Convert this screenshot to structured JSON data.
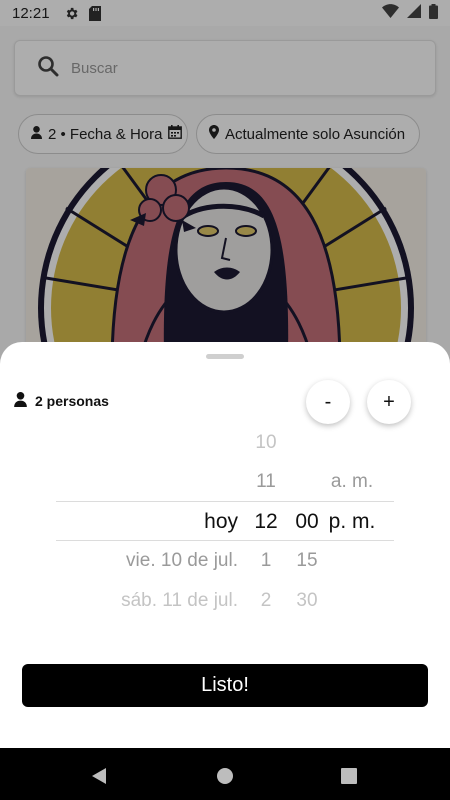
{
  "status_bar": {
    "time": "12:21",
    "icons": [
      "settings-icon",
      "sd-card-icon",
      "wifi-icon",
      "signal-icon",
      "battery-icon"
    ]
  },
  "search": {
    "placeholder": "Buscar",
    "icon": "search-icon"
  },
  "filters": {
    "people_date_chip": "2 • Fecha & Hora",
    "location_chip": "Actualmente solo Asunción"
  },
  "sheet": {
    "people_label": "2 personas",
    "minus_label": "-",
    "plus_label": "+",
    "picker": {
      "date": [
        {
          "label": "",
          "state": "n2"
        },
        {
          "label": "",
          "state": "n1"
        },
        {
          "label": "hoy",
          "state": "sel"
        },
        {
          "label": "vie. 10 de jul.",
          "state": "n1"
        },
        {
          "label": "sáb. 11 de jul.",
          "state": "n2"
        }
      ],
      "hour": [
        {
          "label": "10",
          "state": "n2"
        },
        {
          "label": "11",
          "state": "n1"
        },
        {
          "label": "12",
          "state": "sel"
        },
        {
          "label": "1",
          "state": "n1"
        },
        {
          "label": "2",
          "state": "n2"
        }
      ],
      "minute": [
        {
          "label": "",
          "state": "n2"
        },
        {
          "label": "",
          "state": "n1"
        },
        {
          "label": "00",
          "state": "sel"
        },
        {
          "label": "15",
          "state": "n1"
        },
        {
          "label": "30",
          "state": "n2"
        }
      ],
      "ampm": [
        {
          "label": "",
          "state": "n2"
        },
        {
          "label": "a. m.",
          "state": "n1"
        },
        {
          "label": "p. m.",
          "state": "sel"
        },
        {
          "label": "",
          "state": "n1"
        },
        {
          "label": "",
          "state": "n2"
        }
      ]
    },
    "done_label": "Listo!"
  },
  "nav": {
    "back": "back-triangle-icon",
    "home": "home-circle-icon",
    "recents": "recents-square-icon"
  },
  "colors": {
    "sheet_bg": "#ffffff",
    "button_bg": "#000000",
    "scrim": "rgba(0,0,0,0.32)"
  }
}
